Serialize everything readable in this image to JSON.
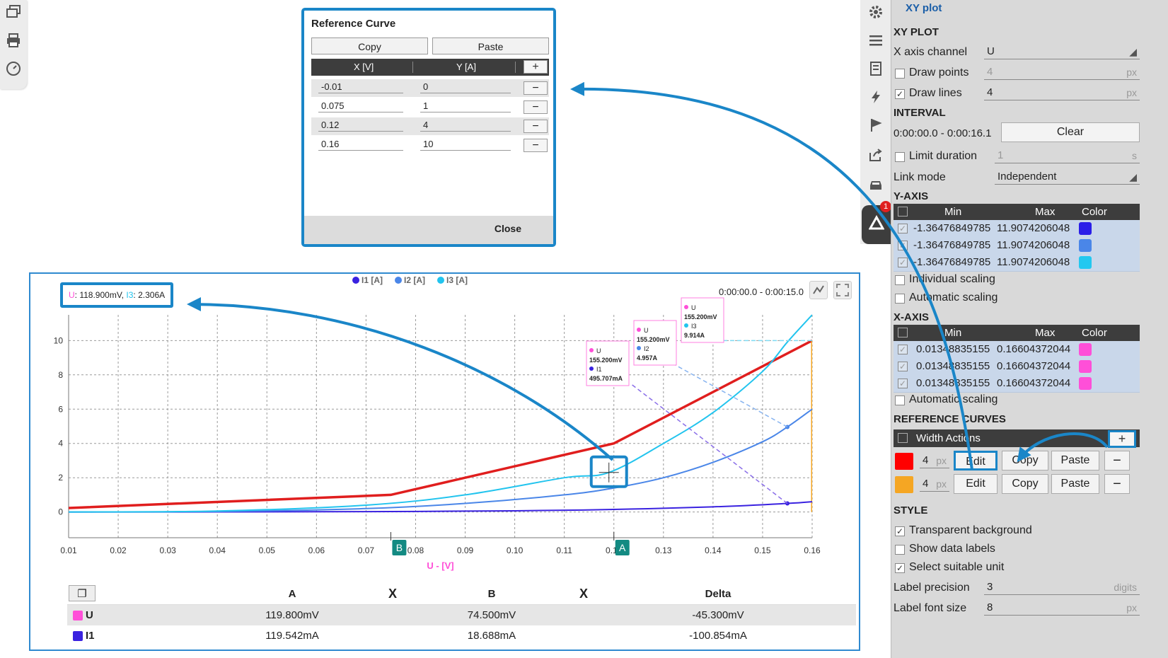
{
  "dialog": {
    "title": "Reference Curve",
    "copy_label": "Copy",
    "paste_label": "Paste",
    "col_x": "X [V]",
    "col_y": "Y [A]",
    "rows": [
      {
        "x": "-0.01",
        "y": "0"
      },
      {
        "x": "0.075",
        "y": "1"
      },
      {
        "x": "0.12",
        "y": "4"
      },
      {
        "x": "0.16",
        "y": "10"
      }
    ],
    "close_label": "Close"
  },
  "chart": {
    "readout_u_label": "U",
    "readout_u_value": ": 118.900mV, ",
    "readout_i3_label": "I3",
    "readout_i3_value": ": 2.306A",
    "interval": "0:00:00.0 - 0:00:15.0",
    "legend": [
      "I1 [A]",
      "I2 [A]",
      "I3 [A]"
    ],
    "xlabel": "U - [V]",
    "marker_a": "A",
    "marker_b": "B",
    "tooltips": [
      {
        "l1": "U",
        "v1": "155.200mV",
        "l2": "I1",
        "v2": "495.707mA"
      },
      {
        "l1": "U",
        "v1": "155.200mV",
        "l2": "I2",
        "v2": "4.957A"
      },
      {
        "l1": "U",
        "v1": "155.200mV",
        "l2": "I3",
        "v2": "9.914A"
      }
    ]
  },
  "chart_data": {
    "type": "line",
    "xlabel": "U - [V]",
    "ylabel": "",
    "xlim": [
      0.01,
      0.16
    ],
    "ylim": [
      -1.5,
      11.5
    ],
    "xticks": [
      "0.01",
      "0.02",
      "0.03",
      "0.04",
      "0.05",
      "0.06",
      "0.07",
      "0.08",
      "0.09",
      "0.10",
      "0.11",
      "0.12",
      "0.13",
      "0.14",
      "0.15",
      "0.16"
    ],
    "yticks": [
      "0",
      "2",
      "4",
      "6",
      "8",
      "10"
    ],
    "grid": true,
    "legend_position": "top-center",
    "series": [
      {
        "name": "I1 [A]",
        "color": "#3a22e0",
        "x": [
          0.01,
          0.04,
          0.07,
          0.1,
          0.12,
          0.14,
          0.155,
          0.16
        ],
        "y": [
          0.0,
          0.005,
          0.02,
          0.07,
          0.15,
          0.3,
          0.5,
          0.6
        ]
      },
      {
        "name": "I2 [A]",
        "color": "#4a86e8",
        "x": [
          0.01,
          0.04,
          0.07,
          0.09,
          0.11,
          0.12,
          0.13,
          0.14,
          0.15,
          0.155,
          0.16
        ],
        "y": [
          0.0,
          0.03,
          0.2,
          0.5,
          1.0,
          1.4,
          2.0,
          2.9,
          4.1,
          4.96,
          6.0
        ]
      },
      {
        "name": "I3 [A]",
        "color": "#22c4ee",
        "x": [
          0.01,
          0.04,
          0.07,
          0.09,
          0.11,
          0.119,
          0.13,
          0.14,
          0.15,
          0.155,
          0.16
        ],
        "y": [
          0.0,
          0.06,
          0.4,
          1.0,
          2.0,
          2.306,
          4.0,
          5.8,
          8.2,
          9.914,
          11.5
        ]
      }
    ],
    "reference_curves": [
      {
        "color": "#e01e1e",
        "x": [
          -0.01,
          0.075,
          0.12,
          0.16
        ],
        "y": [
          0,
          1,
          4,
          10
        ]
      },
      {
        "color": "#f5a623",
        "x": [
          0.16,
          0.16
        ],
        "y": [
          0,
          10
        ]
      }
    ],
    "cursors": {
      "A": 0.12,
      "B": 0.075
    }
  },
  "cursor_table": {
    "headers": {
      "a": "A",
      "x1": "X",
      "b": "B",
      "x2": "X",
      "delta": "Delta"
    },
    "rows": [
      {
        "name": "U",
        "color": "#ff4fd8",
        "a": "119.800mV",
        "b": "74.500mV",
        "delta": "-45.300mV"
      },
      {
        "name": "I1",
        "color": "#3a22e0",
        "a": "119.542mA",
        "b": "18.688mA",
        "delta": "-100.854mA"
      }
    ]
  },
  "panel": {
    "title": "XY plot",
    "xy_head": "XY PLOT",
    "x_channel_label": "X axis channel",
    "x_channel_value": "U",
    "draw_points_label": "Draw points",
    "draw_points_value": "4",
    "draw_lines_label": "Draw lines",
    "draw_lines_value": "4",
    "px": "px",
    "interval_head": "INTERVAL",
    "interval_value": "0:00:00.0 - 0:00:16.1",
    "clear_label": "Clear",
    "limit_label": "Limit duration",
    "limit_value": "1",
    "s": "s",
    "link_label": "Link mode",
    "link_value": "Independent",
    "yaxis_head": "Y-AXIS",
    "col_min": "Min",
    "col_max": "Max",
    "col_color": "Color",
    "y_rows": [
      {
        "min": "-1.36476849785",
        "max": "11.9074206048",
        "color": "#2a1ee8"
      },
      {
        "min": "-1.36476849785",
        "max": "11.9074206048",
        "color": "#4a86e8"
      },
      {
        "min": "-1.36476849785",
        "max": "11.9074206048",
        "color": "#22c8f0"
      }
    ],
    "individual_label": "Individual scaling",
    "automatic_label": "Automatic scaling",
    "xaxis_head": "X-AXIS",
    "x_rows": [
      {
        "min": "0.01348835155",
        "max": "0.16604372044",
        "color": "#ff4fd8"
      },
      {
        "min": "0.01348835155",
        "max": "0.16604372044",
        "color": "#ff4fd8"
      },
      {
        "min": "0.01348835155",
        "max": "0.16604372044",
        "color": "#ff4fd8"
      }
    ],
    "x_automatic_label": "Automatic scaling",
    "ref_head": "REFERENCE CURVES",
    "ref_col_header": "Width Actions",
    "ref_rows": [
      {
        "color": "#ff0000",
        "width": "4",
        "edit": "Edit",
        "copy": "Copy",
        "paste": "Paste"
      },
      {
        "color": "#f5a623",
        "width": "4",
        "edit": "Edit",
        "copy": "Copy",
        "paste": "Paste"
      }
    ],
    "style_head": "STYLE",
    "transparent_label": "Transparent background",
    "show_labels_label": "Show data labels",
    "suitable_label": "Select suitable unit",
    "precision_label": "Label precision",
    "precision_value": "3",
    "digits": "digits",
    "font_label": "Label font size",
    "font_value": "8",
    "badge": "1"
  }
}
